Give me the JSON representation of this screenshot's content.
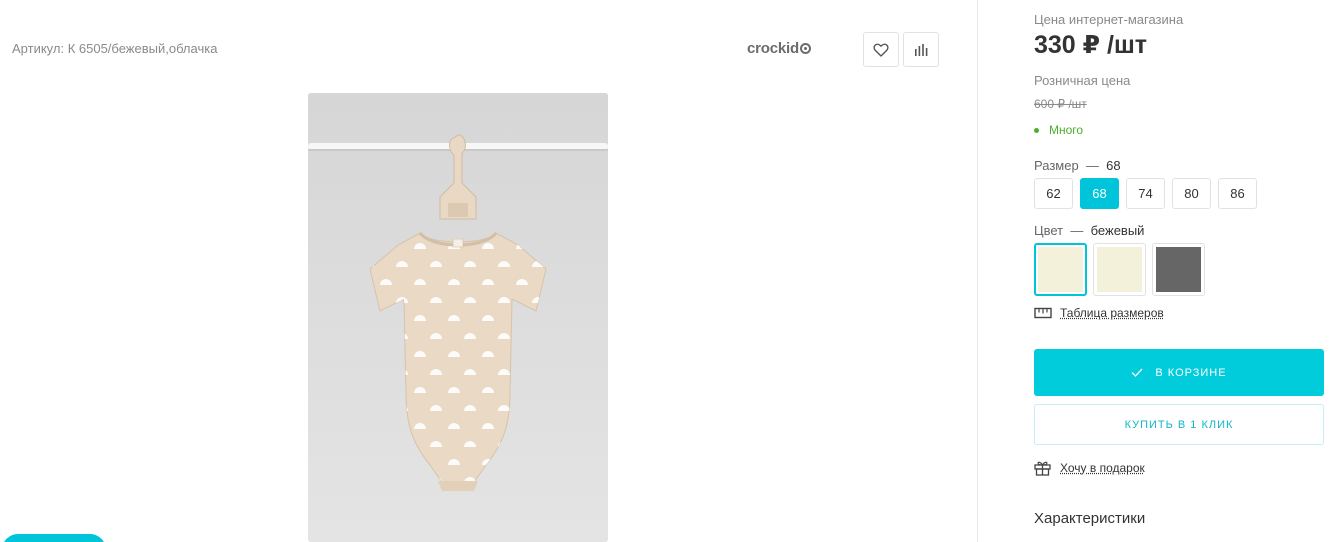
{
  "product": {
    "article": "Артикул: К 6505/бежевый,облачка",
    "brand": "crockid",
    "photo_alt": "Боди бежевый облачка"
  },
  "actions": {
    "favorite_icon": "heart-icon",
    "compare_icon": "bar-chart-icon"
  },
  "pricing": {
    "online_caption": "Цена интернет-магазина",
    "price": "330 ₽ /шт",
    "retail_caption": "Розничная цена",
    "old_price": "600 ₽ /шт"
  },
  "stock": {
    "label": "Много",
    "color": "#4caf2c"
  },
  "size": {
    "label": "Размер",
    "separator": "—",
    "selected": "68",
    "options": [
      "62",
      "68",
      "74",
      "80",
      "86"
    ]
  },
  "color": {
    "label": "Цвет",
    "separator": "—",
    "selected": "бежевый",
    "swatches": [
      {
        "hex": "#f4f1da",
        "active": true
      },
      {
        "hex": "#f4f1da",
        "active": false
      },
      {
        "hex": "#666666",
        "active": false
      }
    ]
  },
  "links": {
    "size_table": "Таблица размеров",
    "gift": "Хочу в подарок"
  },
  "buttons": {
    "in_cart": "В КОРЗИНЕ",
    "one_click": "КУПИТЬ В 1 КЛИК"
  },
  "section": {
    "characteristics": "Характеристики"
  },
  "theme": {
    "accent": "#00ccdc",
    "accent_text": "#12b7c8"
  }
}
